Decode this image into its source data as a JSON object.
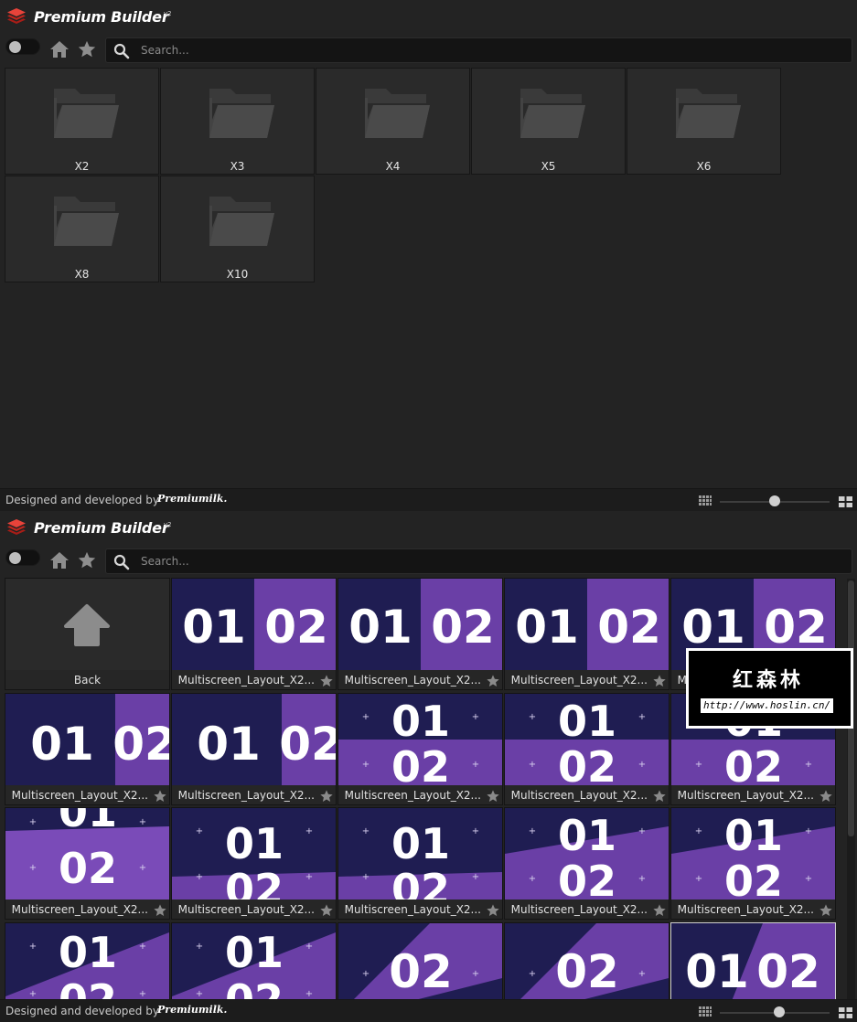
{
  "app": {
    "title": "Premium Builder",
    "version": "v2"
  },
  "search": {
    "placeholder": "Search..."
  },
  "panel1": {
    "folders": [
      {
        "label": "X2",
        "icon": "folder-icon"
      },
      {
        "label": "X3",
        "icon": "folder-icon"
      },
      {
        "label": "X4",
        "icon": "folder-icon"
      },
      {
        "label": "X5",
        "icon": "folder-icon"
      },
      {
        "label": "X6",
        "icon": "folder-icon"
      },
      {
        "label": "X8",
        "icon": "folder-icon"
      },
      {
        "label": "X10",
        "icon": "folder-icon"
      }
    ],
    "zoom_level": 0.5
  },
  "panel2": {
    "back_label": "Back",
    "tile_label": "Multiscreen_Layout_X2...",
    "zoom_level": 0.54
  },
  "footer": {
    "text": "Designed and developed by",
    "brand": "Premiumilk."
  },
  "watermark": {
    "title": "红森林",
    "url": "http://www.hoslin.cn/"
  },
  "colors": {
    "accent": "#e0342b",
    "background": "#232323",
    "thumb_purple": "#6a3fa6",
    "thumb_navy": "#1f1d52"
  }
}
